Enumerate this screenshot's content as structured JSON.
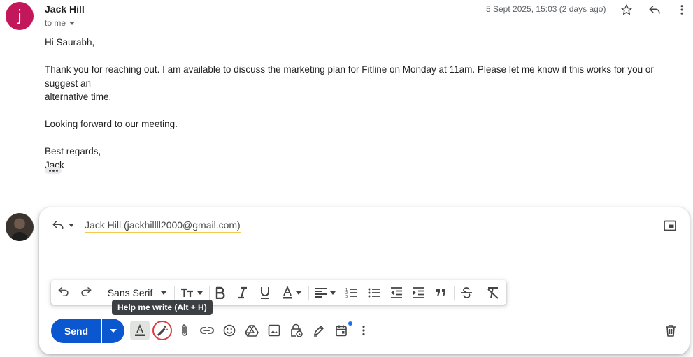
{
  "message": {
    "avatar_letter": "j",
    "sender_name": "Jack Hill",
    "to_label": "to me",
    "date": "5 Sept 2025, 15:03 (2 days ago)",
    "body": {
      "greeting": "Hi Saurabh,",
      "paragraph1_line1": "Thank you for reaching out. I am available to discuss the marketing plan for Fitline on Monday at 11am. Please let me know if this works for you or suggest an",
      "paragraph1_line2": "alternative time.",
      "paragraph2": "Looking forward to our meeting.",
      "closing": "Best regards,",
      "signature": "Jack"
    }
  },
  "reply": {
    "recipient": "Jack Hill (jackhillll2000@gmail.com)",
    "toolbar": {
      "font_name": "Sans Serif"
    },
    "tooltip": "Help me write (Alt + H)",
    "send_label": "Send"
  },
  "colors": {
    "sender_avatar": "#c2185b",
    "send_button": "#0b57d0",
    "highlight_ring": "#e03b3b",
    "notification_dot": "#1a73e8"
  }
}
